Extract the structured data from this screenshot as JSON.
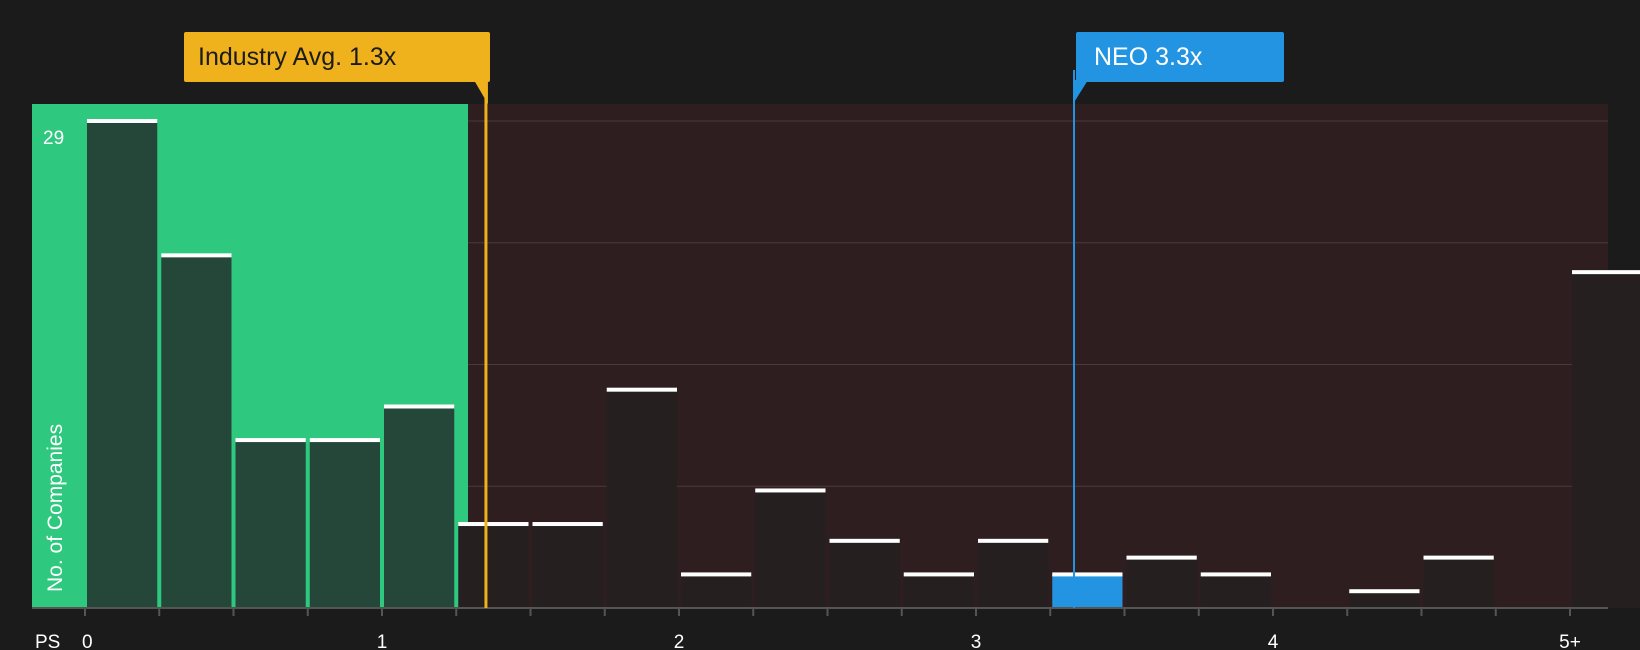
{
  "chart_data": {
    "type": "bar",
    "xlabel": "PS",
    "ylabel": "No. of Companies",
    "y_max_label": "29",
    "ylim": [
      0,
      29
    ],
    "xlim": [
      0,
      5.2
    ],
    "x_ticks": [
      "0",
      "1",
      "2",
      "3",
      "4",
      "5+"
    ],
    "bin_width": 0.25,
    "bins": [
      {
        "x0": 0.0,
        "value": 29
      },
      {
        "x0": 0.25,
        "value": 21
      },
      {
        "x0": 0.5,
        "value": 10
      },
      {
        "x0": 0.75,
        "value": 10
      },
      {
        "x0": 1.0,
        "value": 12
      },
      {
        "x0": 1.25,
        "value": 5
      },
      {
        "x0": 1.5,
        "value": 5
      },
      {
        "x0": 1.75,
        "value": 13
      },
      {
        "x0": 2.0,
        "value": 2
      },
      {
        "x0": 2.25,
        "value": 7
      },
      {
        "x0": 2.5,
        "value": 4
      },
      {
        "x0": 2.75,
        "value": 2
      },
      {
        "x0": 3.0,
        "value": 4
      },
      {
        "x0": 3.25,
        "value": 2,
        "highlight": true
      },
      {
        "x0": 3.5,
        "value": 3
      },
      {
        "x0": 3.75,
        "value": 2
      },
      {
        "x0": 4.0,
        "value": 0
      },
      {
        "x0": 4.25,
        "value": 1
      },
      {
        "x0": 4.5,
        "value": 3
      },
      {
        "x0": 4.75,
        "value": 0
      },
      {
        "x0": 5.0,
        "value": 20
      }
    ],
    "fair_region_end": 1.29,
    "industry_avg": {
      "label": "Industry Avg. 1.3x",
      "value": 1.35
    },
    "company": {
      "label": "NEO 3.3x",
      "value": 3.33
    },
    "grid": true
  },
  "colors": {
    "background": "#1b1b1b",
    "fair_region": "#2ec87f",
    "over_region": "#2f1e1f",
    "bar_in_region": "#24473a",
    "bar_over": "#251f1f",
    "bar_highlight": "#2394e2",
    "industry": "#efb21d",
    "company": "#2394e2",
    "grid": "#4a3a3a"
  }
}
